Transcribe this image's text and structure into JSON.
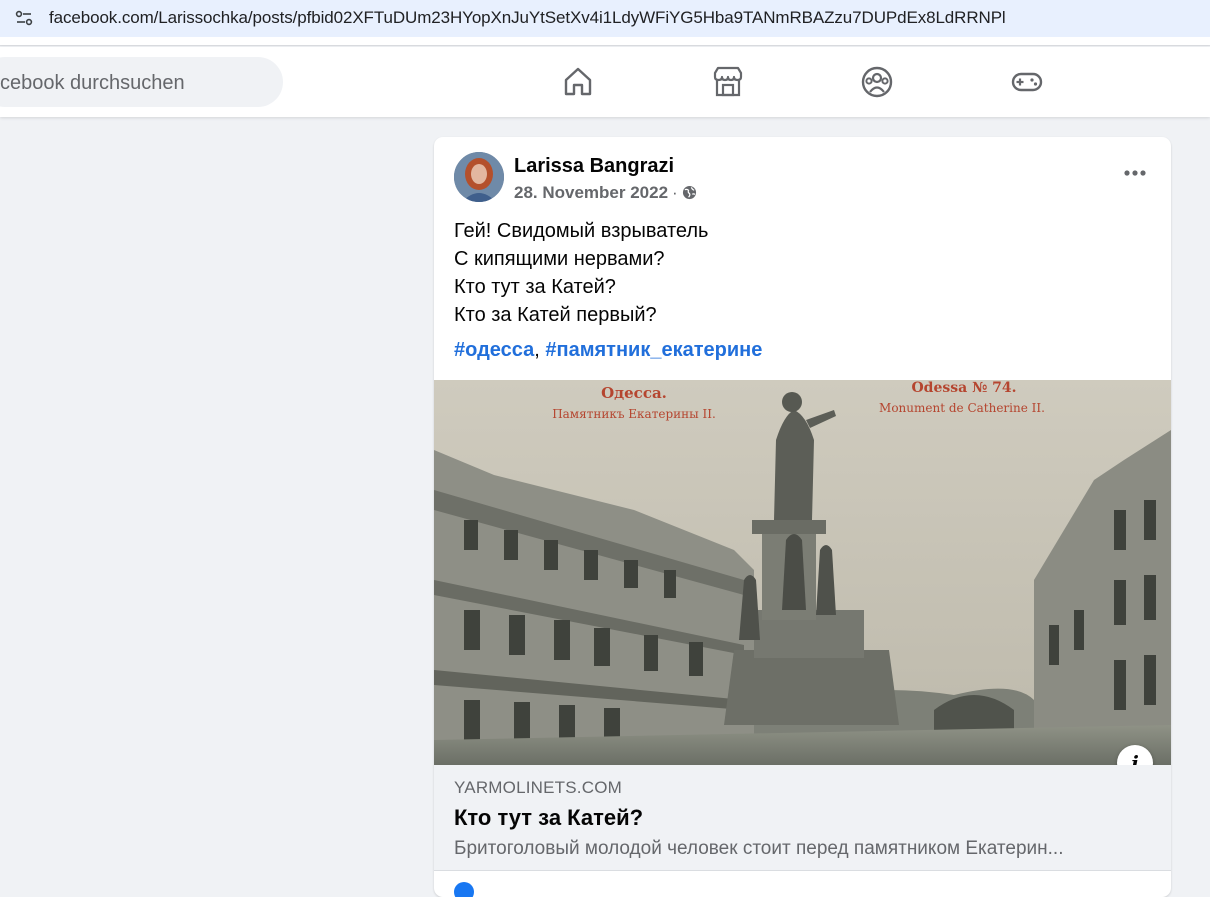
{
  "browser": {
    "url": "facebook.com/Larissochka/posts/pfbid02XFTuDUm23HYopXnJuYtSetXv4i1LdyWFiYG5Hba9TANmRBAZzu7DUPdEx8LdRRNPl"
  },
  "topbar": {
    "search_placeholder": "cebook durchsuchen",
    "nav": [
      "home-icon",
      "marketplace-icon",
      "groups-icon",
      "gaming-icon"
    ]
  },
  "post": {
    "author": "Larissa Bangrazi",
    "date": "28. November 2022",
    "separator": "·",
    "text_lines": [
      "Гей! Свидомый взрыватель",
      "С кипящими нервами?",
      "Кто тут за Катей?",
      "Кто за Катей первый?"
    ],
    "hashtags": [
      "#одесса",
      "#памятник_екатерине"
    ],
    "hashtag_separator": ",",
    "link_preview": {
      "image_caption_left": "Одесса.",
      "image_caption_left_sub": "Памятникъ Екатерины II.",
      "image_caption_right": "Odessa № 74.",
      "image_caption_right_sub": "Monument de Catherine II.",
      "domain": "YARMOLINETS.COM",
      "title": "Кто тут за Катей?",
      "description": "Бритоголовый молодой человек стоит перед памятником Екатерин..."
    }
  },
  "colors": {
    "background": "#f0f2f5",
    "link": "#216fdb",
    "secondary_text": "#65676b",
    "url_bar": "#e8f0fe"
  }
}
